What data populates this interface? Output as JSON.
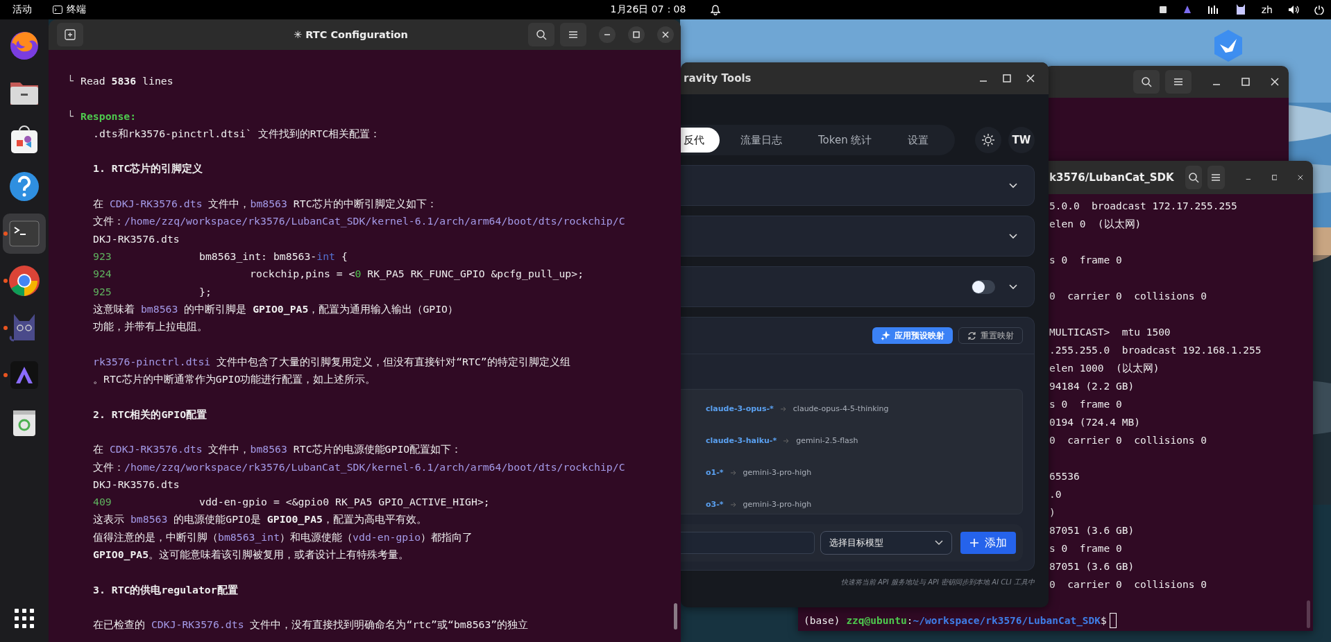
{
  "top_bar": {
    "activities": "活动",
    "app_name": "终端",
    "clock": "1月26日  07：08",
    "language": "zh"
  },
  "dock": {
    "apps": [
      {
        "kind": "firefox",
        "running": false,
        "selected": false
      },
      {
        "kind": "files",
        "running": false,
        "selected": false
      },
      {
        "kind": "store",
        "running": false,
        "selected": false
      },
      {
        "kind": "help",
        "running": false,
        "selected": false
      },
      {
        "kind": "terminal",
        "running": true,
        "selected": true
      },
      {
        "kind": "chrome",
        "running": true,
        "selected": false
      },
      {
        "kind": "cat",
        "running": true,
        "selected": false
      },
      {
        "kind": "letter-app",
        "running": true,
        "selected": false
      },
      {
        "kind": "trash",
        "running": false,
        "selected": false
      }
    ]
  },
  "main_terminal": {
    "title": "✳ RTC Configuration",
    "lines": [
      {
        "kind": "tree",
        "marker": "└",
        "segments": [
          {
            "text": "Read ",
            "kind": "plain"
          },
          {
            "text": "5836",
            "kind": "bold"
          },
          {
            "text": " lines",
            "kind": "plain"
          }
        ]
      },
      {
        "kind": "blank"
      },
      {
        "kind": "tree",
        "marker": "└",
        "segments": [
          {
            "text": "Response:",
            "kind": "label"
          }
        ]
      },
      {
        "kind": "text",
        "segments": [
          {
            "text": ".dts和rk3576-pinctrl.dtsi` 文件找到的RTC相关配置：",
            "kind": "plain"
          }
        ]
      },
      {
        "kind": "blank"
      },
      {
        "kind": "heading",
        "text": "1. RTC芯片的引脚定义"
      },
      {
        "kind": "blank"
      },
      {
        "kind": "text",
        "segments": [
          {
            "text": "在 ",
            "kind": "plain"
          },
          {
            "text": "CDKJ-RK3576.dts",
            "kind": "code"
          },
          {
            "text": " 文件中，",
            "kind": "plain"
          },
          {
            "text": "bm8563",
            "kind": "code"
          },
          {
            "text": " RTC芯片的中断引脚定义如下：",
            "kind": "plain"
          }
        ]
      },
      {
        "kind": "text",
        "segments": [
          {
            "text": "文件：",
            "kind": "plain"
          },
          {
            "text": "/home/zzq/workspace/rk3576/LubanCat_SDK/kernel-6.1/arch/arm64/boot/dts/rockchip/C",
            "kind": "code"
          }
        ]
      },
      {
        "kind": "text",
        "segments": [
          {
            "text": "DKJ-RK3576.dts",
            "kind": "plain"
          }
        ]
      },
      {
        "kind": "code",
        "number": "923",
        "segments": [
          {
            "text": "bm8563_int: bm8563-",
            "kind": "plain"
          },
          {
            "text": "int",
            "kind": "keyword"
          },
          {
            "text": " {",
            "kind": "plain"
          }
        ],
        "children": [
          {
            "kind": "code",
            "number": "924",
            "segments": [
              {
                "text": "rockchip,pins = <",
                "kind": "plain"
              },
              {
                "text": "0",
                "kind": "number"
              },
              {
                "text": " RK_PA5 RK_FUNC_GPIO &pcfg_pull_up>;",
                "kind": "plain"
              }
            ]
          }
        ]
      },
      {
        "kind": "code",
        "number": "925",
        "segments": [
          {
            "text": "};",
            "kind": "plain"
          }
        ]
      },
      {
        "kind": "text",
        "segments": [
          {
            "text": "这意味着 ",
            "kind": "plain"
          },
          {
            "text": "bm8563",
            "kind": "code"
          },
          {
            "text": " 的中断引脚是 ",
            "kind": "plain"
          },
          {
            "text": "GPIO0_PA5",
            "kind": "bold"
          },
          {
            "text": "，配置为通用输入输出（GPIO）",
            "kind": "plain"
          }
        ]
      },
      {
        "kind": "text",
        "segments": [
          {
            "text": "功能，并带有上拉电阻。",
            "kind": "plain"
          }
        ]
      },
      {
        "kind": "blank"
      },
      {
        "kind": "text",
        "segments": [
          {
            "text": "rk3576-pinctrl.dtsi",
            "kind": "code"
          },
          {
            "text": " 文件中包含了大量的引脚复用定义，但没有直接针对“RTC”的特定引脚定义组",
            "kind": "plain"
          }
        ]
      },
      {
        "kind": "text",
        "segments": [
          {
            "text": "。RTC芯片的中断通常作为GPIO功能进行配置，如上述所示。",
            "kind": "plain"
          }
        ]
      },
      {
        "kind": "blank"
      },
      {
        "kind": "heading",
        "text": "2. RTC相关的GPIO配置"
      },
      {
        "kind": "blank"
      },
      {
        "kind": "text",
        "segments": [
          {
            "text": "在 ",
            "kind": "plain"
          },
          {
            "text": "CDKJ-RK3576.dts",
            "kind": "code"
          },
          {
            "text": " 文件中，",
            "kind": "plain"
          },
          {
            "text": "bm8563",
            "kind": "code"
          },
          {
            "text": " RTC芯片的电源使能GPIO配置如下：",
            "kind": "plain"
          }
        ]
      },
      {
        "kind": "text",
        "segments": [
          {
            "text": "文件：",
            "kind": "plain"
          },
          {
            "text": "/home/zzq/workspace/rk3576/LubanCat_SDK/kernel-6.1/arch/arm64/boot/dts/rockchip/C",
            "kind": "code"
          }
        ]
      },
      {
        "kind": "text",
        "segments": [
          {
            "text": "DKJ-RK3576.dts",
            "kind": "plain"
          }
        ]
      },
      {
        "kind": "code",
        "number": "409",
        "segments": [
          {
            "text": "vdd-en-gpio = <&gpio0 RK_PA5 GPIO_ACTIVE_HIGH>;",
            "kind": "plain"
          }
        ]
      },
      {
        "kind": "text",
        "segments": [
          {
            "text": "这表示 ",
            "kind": "plain"
          },
          {
            "text": "bm8563",
            "kind": "code"
          },
          {
            "text": " 的电源使能GPIO是 ",
            "kind": "plain"
          },
          {
            "text": "GPIO0_PA5",
            "kind": "bold"
          },
          {
            "text": "，配置为高电平有效。",
            "kind": "plain"
          }
        ]
      },
      {
        "kind": "text",
        "segments": [
          {
            "text": "值得注意的是，中断引脚（",
            "kind": "plain"
          },
          {
            "text": "bm8563_int",
            "kind": "code"
          },
          {
            "text": "）和电源使能（",
            "kind": "plain"
          },
          {
            "text": "vdd-en-gpio",
            "kind": "code"
          },
          {
            "text": "）都指向了",
            "kind": "plain"
          }
        ]
      },
      {
        "kind": "text",
        "segments": [
          {
            "text": "GPIO0_PA5",
            "kind": "bold"
          },
          {
            "text": "。这可能意味着该引脚被复用，或者设计上有特殊考量。",
            "kind": "plain"
          }
        ]
      },
      {
        "kind": "blank"
      },
      {
        "kind": "heading",
        "text": "3. RTC的供电regulator配置"
      },
      {
        "kind": "blank"
      },
      {
        "kind": "text",
        "segments": [
          {
            "text": "在已检查的 ",
            "kind": "plain"
          },
          {
            "text": "CDKJ-RK3576.dts",
            "kind": "code"
          },
          {
            "text": " 文件中，没有直接找到明确命名为“rtc”或“bm8563”的独立",
            "kind": "plain"
          }
        ]
      }
    ]
  },
  "proxy_app": {
    "title": "ravity Tools",
    "tabs": [
      {
        "label": "反代",
        "selected": true
      },
      {
        "label": "流量日志",
        "selected": false
      },
      {
        "label": "Token 统计",
        "selected": false
      },
      {
        "label": "设置",
        "selected": false
      }
    ],
    "avatar": "TW",
    "sections": [
      {
        "kind": "collapsible"
      },
      {
        "kind": "collapsible"
      },
      {
        "kind": "toggle",
        "on": false
      }
    ],
    "apply_button": "应用预设映射",
    "reset_button": "重置映射",
    "rules": [
      {
        "source": "claude-3-opus-*",
        "target": "claude-opus-4-5-thinking"
      },
      {
        "source": "claude-3-haiku-*",
        "target": "gemini-2.5-flash"
      },
      {
        "source": "o1-*",
        "target": "gemini-3-pro-high"
      },
      {
        "source": "o3-*",
        "target": "gemini-3-pro-high"
      }
    ],
    "target_select": {
      "placeholder": "选择目标模型"
    },
    "add_button": "添加",
    "footer": "快速将当前 API 服务地址与 API 密钥同步到本地 AI CLI 工具中"
  },
  "front_terminal": {
    "title": "k3576/LubanCat_SDK",
    "lines": [
      {
        "kind": "output",
        "text": "5.0.0  broadcast 172.17.255.255"
      },
      {
        "kind": "output",
        "text": "elen 0  (以太网)"
      },
      {
        "kind": "blank"
      },
      {
        "kind": "output",
        "text": "s 0  frame 0"
      },
      {
        "kind": "blank"
      },
      {
        "kind": "output",
        "text": "0  carrier 0  collisions 0"
      },
      {
        "kind": "blank"
      },
      {
        "kind": "output",
        "text": "MULTICAST>  mtu 1500"
      },
      {
        "kind": "output",
        "text": ".255.255.0  broadcast 192.168.1.255"
      },
      {
        "kind": "output",
        "text": "elen 1000  (以太网)"
      },
      {
        "kind": "output",
        "text": "94184 (2.2 GB)"
      },
      {
        "kind": "output",
        "text": "s 0  frame 0"
      },
      {
        "kind": "output",
        "text": "0194 (724.4 MB)"
      },
      {
        "kind": "output",
        "text": "0  carrier 0  collisions 0"
      },
      {
        "kind": "blank"
      },
      {
        "kind": "output",
        "text": "65536"
      },
      {
        "kind": "output",
        "text": ".0"
      },
      {
        "kind": "output",
        "text": ")"
      },
      {
        "kind": "output",
        "text": "87051 (3.6 GB)"
      },
      {
        "kind": "output",
        "text": "s 0  frame 0"
      },
      {
        "kind": "output",
        "text": "87051 (3.6 GB)"
      },
      {
        "kind": "output",
        "text": "0  carrier 0  collisions 0"
      },
      {
        "kind": "blank"
      }
    ],
    "prompt": {
      "env": "(base)",
      "user": "zzq@ubuntu",
      "colon": ":",
      "path": "~/workspace/rk3576/LubanCat_SDK",
      "symbol": "$"
    }
  }
}
